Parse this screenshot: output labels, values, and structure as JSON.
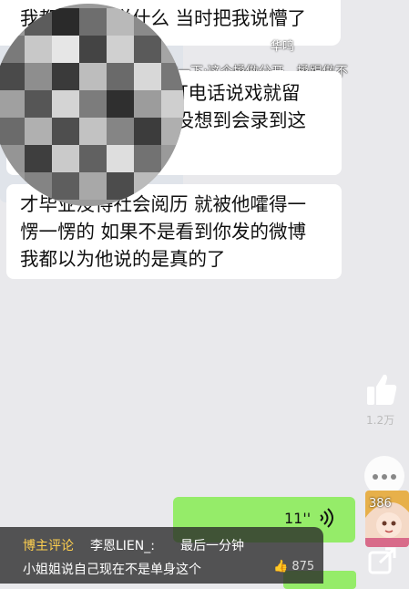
{
  "messages": [
    {
      "lines": [
        "我都不知道说什么 当时把我说懵了"
      ]
    },
    {
      "lines": [
        "因为第一次跟导演打电话说戏就留",
        "了个心眼录音 实在没想到会录到这",
        "些东西"
      ]
    },
    {
      "lines": [
        "才毕业没得社会阅历 就被他嚯得一",
        "愣一愣的 如果不是看到你发的微博",
        "我都以为他说的是真的了"
      ]
    }
  ],
  "overlay_top": "华鸣",
  "scrolling_caption": "搡做一下:这个搡做分开，搡跟做不",
  "voice_message": {
    "duration": "11''",
    "icon": "voice-wave-icon"
  },
  "right_rail": {
    "like_count": "1.2万",
    "avatar_count": "386",
    "icons": [
      "like-icon",
      "more-icon",
      "share-icon"
    ]
  },
  "comment": {
    "tag": "博主评论",
    "user": "李恩LIEN_:",
    "text_line1": "最后一分钟",
    "text_line2": "小姐姐说自己现在不是单身这个",
    "likes": "875"
  },
  "colors": {
    "background": "#e9e9ec",
    "bubble_incoming": "#ffffff",
    "bubble_outgoing": "#95ec69",
    "tag": "#ffd04f"
  }
}
